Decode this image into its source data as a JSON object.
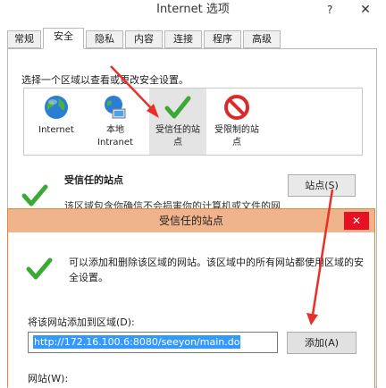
{
  "window": {
    "title": "Internet 选项",
    "help": "?",
    "close": "✕"
  },
  "tabs": [
    "常规",
    "安全",
    "隐私",
    "内容",
    "连接",
    "程序",
    "高级"
  ],
  "security": {
    "hint": "选择一个区域以查看或更改安全设置。",
    "zones": [
      {
        "label": "Internet",
        "icon": "globe-icon"
      },
      {
        "label": "本地 Intranet",
        "icon": "intranet-icon"
      },
      {
        "label": "受信任的站点",
        "icon": "checkmark-icon",
        "selected": true
      },
      {
        "label": "受限制的站点",
        "icon": "restricted-icon"
      }
    ],
    "section_title": "受信任的站点",
    "section_desc": "该区域包含你确信不会损害你的计算机或文件的网",
    "sites_button": "站点(S)"
  },
  "dialog": {
    "title": "受信任的站点",
    "close": "✕",
    "description": "可以添加和删除该区域的网站。该区域中的所有网站都使用区域的安全设置。",
    "add_label": "将该网站添加到区域(D):",
    "url_value": "http://172.16.100.6:8080/seeyon/main.do",
    "add_button": "添加(A)",
    "sites_label": "网站(W):"
  },
  "colors": {
    "accent_red": "#e8302a",
    "check_green": "#3aaa35",
    "selection": "#3399ff"
  }
}
